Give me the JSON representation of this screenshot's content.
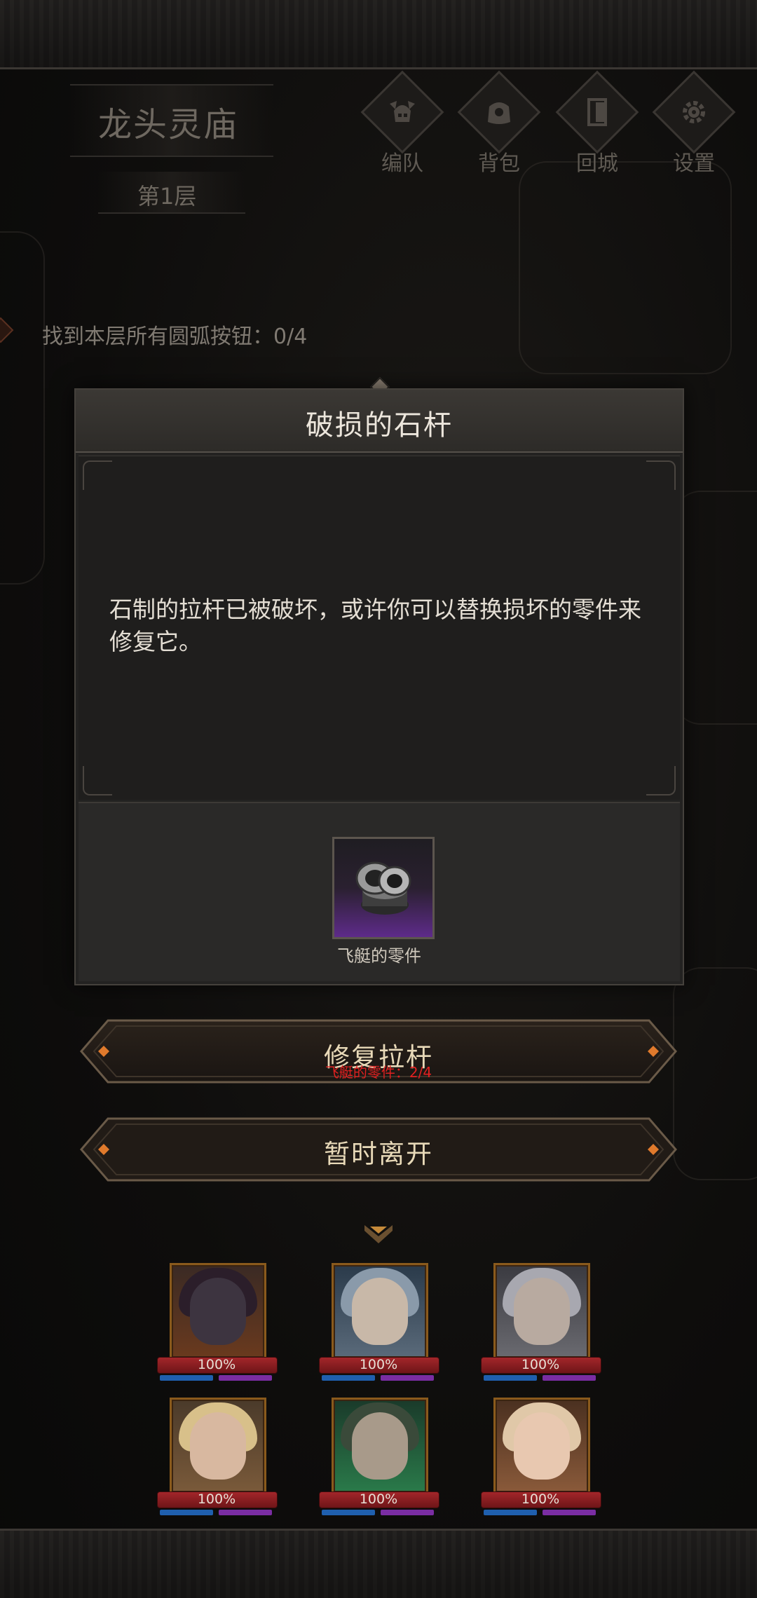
{
  "header": {
    "location": "龙头灵庙",
    "floor": "第1层"
  },
  "menu": [
    {
      "label": "编队",
      "icon": "helmet-icon"
    },
    {
      "label": "背包",
      "icon": "backpack-icon"
    },
    {
      "label": "回城",
      "icon": "door-icon"
    },
    {
      "label": "设置",
      "icon": "gear-icon"
    }
  ],
  "quest": {
    "text": "找到本层所有圆弧按钮：0/4"
  },
  "dialog": {
    "title": "破损的石杆",
    "description": "石制的拉杆已被破坏，或许你可以替换损坏的零件来修复它。",
    "item": {
      "name": "飞艇的零件",
      "icon": "gear-part-icon"
    }
  },
  "actions": {
    "repair": {
      "label": "修复拉杆",
      "requirement": "飞艇的零件：2/4"
    },
    "leave": {
      "label": "暂时离开"
    }
  },
  "party": {
    "heroes": [
      {
        "hp": "100%"
      },
      {
        "hp": "100%"
      },
      {
        "hp": "100%"
      },
      {
        "hp": "100%"
      },
      {
        "hp": "100%"
      },
      {
        "hp": "100%"
      }
    ]
  },
  "colors": {
    "accent": "#e8d9b8",
    "warning": "#e02020",
    "item_rarity": "#5e2b8a"
  }
}
